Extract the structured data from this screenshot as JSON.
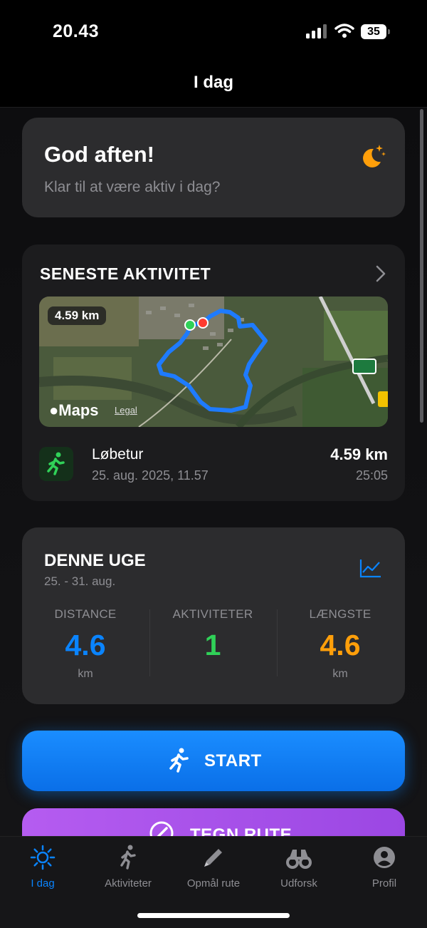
{
  "status_bar": {
    "time": "20.43",
    "battery": "35"
  },
  "nav": {
    "title": "I dag"
  },
  "greeting": {
    "title": "God aften!",
    "subtitle": "Klar til at være aktiv i dag?"
  },
  "recent_activity": {
    "heading": "SENESTE AKTIVITET",
    "map_distance_badge": "4.59 km",
    "maps_brand": "Maps",
    "legal_link": "Legal",
    "activity": {
      "name": "Løbetur",
      "date": "25. aug. 2025, 11.57",
      "distance": "4.59 km",
      "duration": "25:05"
    }
  },
  "week": {
    "heading": "DENNE UGE",
    "range": "25. - 31. aug.",
    "stats": [
      {
        "label": "DISTANCE",
        "value": "4.6",
        "unit": "km",
        "color": "#0a84ff"
      },
      {
        "label": "AKTIVITETER",
        "value": "1",
        "unit": "",
        "color": "#30d158"
      },
      {
        "label": "LÆNGSTE",
        "value": "4.6",
        "unit": "km",
        "color": "#ff9f0a"
      }
    ]
  },
  "actions": {
    "start_label": "START",
    "route_label": "TEGN RUTE"
  },
  "tabs": [
    {
      "label": "I dag",
      "icon": "sun-icon",
      "active": true
    },
    {
      "label": "Aktiviteter",
      "icon": "runner-icon",
      "active": false
    },
    {
      "label": "Opmål rute",
      "icon": "pencil-icon",
      "active": false
    },
    {
      "label": "Udforsk",
      "icon": "binoculars-icon",
      "active": false
    },
    {
      "label": "Profil",
      "icon": "person-circle-icon",
      "active": false
    }
  ],
  "colors": {
    "accent": "#0a84ff",
    "start_button": "#0a84ff",
    "route_button": "#a855f7",
    "card": "#2c2c2e"
  }
}
